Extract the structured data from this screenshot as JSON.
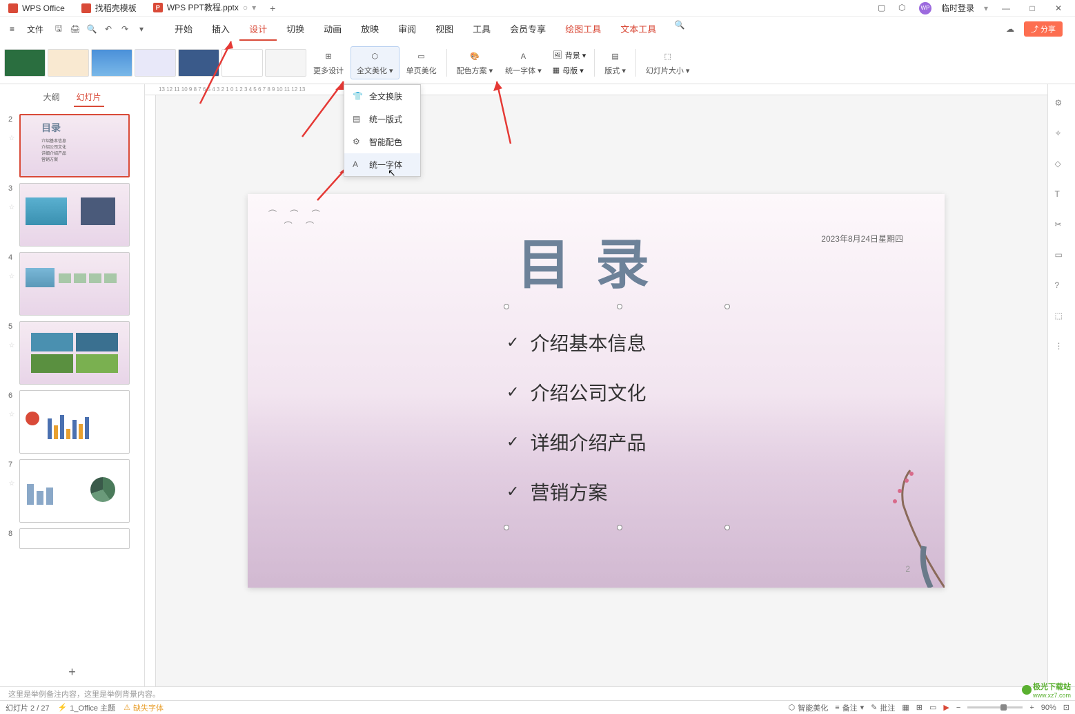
{
  "titlebar": {
    "app_name": "WPS Office",
    "tab2": "找稻壳模板",
    "tab3": "WPS PPT教程.pptx",
    "login": "临时登录"
  },
  "toolbar": {
    "file": "文件",
    "tabs": [
      "开始",
      "插入",
      "设计",
      "切换",
      "动画",
      "放映",
      "审阅",
      "视图",
      "工具",
      "会员专享"
    ],
    "tool_tabs": [
      "绘图工具",
      "文本工具"
    ],
    "share": "分享"
  },
  "ribbon": {
    "more_design": "更多设计",
    "full_beautify": "全文美化",
    "single_beautify": "单页美化",
    "color_scheme": "配色方案",
    "unify_font": "统一字体",
    "background": "背景",
    "master": "母版",
    "format": "版式",
    "slide_size": "幻灯片大小"
  },
  "dropdown": {
    "items": [
      "全文换肤",
      "统一版式",
      "智能配色",
      "统一字体"
    ]
  },
  "left_panel": {
    "tab_outline": "大纲",
    "tab_slides": "幻灯片",
    "nums": [
      "2",
      "3",
      "4",
      "5",
      "6",
      "7",
      "8"
    ]
  },
  "slide": {
    "date": "2023年8月24日星期四",
    "title": "目录",
    "items": [
      "介绍基本信息",
      "介绍公司文化",
      "详细介绍产品",
      "营销方案"
    ],
    "page_num": "2"
  },
  "thumb2": {
    "title": "目录",
    "items": [
      "介绍基本信息",
      "介绍公司文化",
      "详细介绍产品",
      "营销方案"
    ]
  },
  "notes": "这里是举例备注内容，这里是举例背景内容。",
  "statusbar": {
    "slide_info": "幻灯片 2 / 27",
    "theme": "1_Office 主题",
    "missing_font": "缺失字体",
    "smart_beautify": "智能美化",
    "notes": "备注",
    "comments": "批注",
    "zoom": "90%"
  },
  "watermark": {
    "text": "极光下载站",
    "url": "www.xz7.com"
  },
  "ruler": "13    12    11    10    9    8    7    6    5    4    3    2    1    0    1    2    3    4    5    6    7    8    9    10    11    12    13"
}
